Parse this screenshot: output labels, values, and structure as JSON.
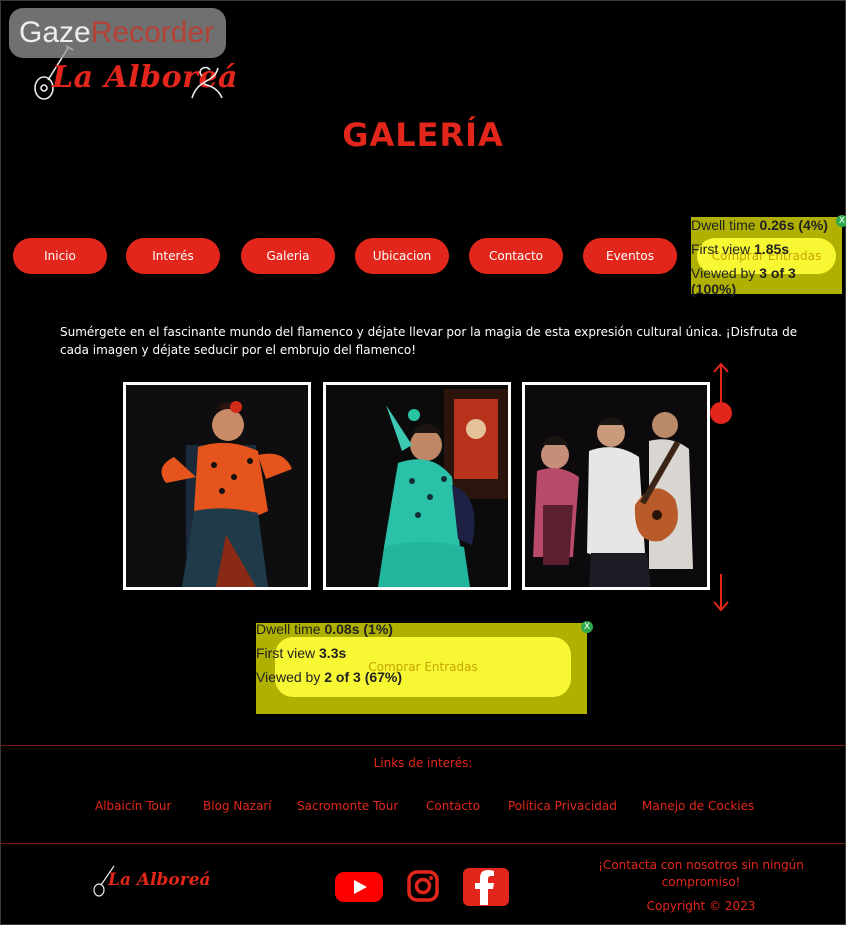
{
  "recorder": {
    "brand_part1": "Gaze",
    "brand_part2": "Recorder"
  },
  "logo": {
    "text": "La Alboreá"
  },
  "page": {
    "title": "GALERÍA"
  },
  "nav": {
    "items": [
      {
        "label": "Inicio"
      },
      {
        "label": "Interés"
      },
      {
        "label": "Galeria"
      },
      {
        "label": "Ubicacion"
      },
      {
        "label": "Contacto"
      },
      {
        "label": "Eventos"
      },
      {
        "label": "Comprar Entradas"
      }
    ]
  },
  "intro": "Sumérgete en el fascinante mundo del flamenco y déjate llevar por la magia de esta expresión cultural única. ¡Disfruta de cada imagen y déjate seducir por el embrujo del flamenco!",
  "gallery": {
    "photos": [
      {
        "alt": "Bailaora con vestido naranja de lunares"
      },
      {
        "alt": "Bailaora con vestido verde de lunares"
      },
      {
        "alt": "Bailaora y guitarrista en escenario"
      }
    ]
  },
  "overlays": [
    {
      "dwell_label": "Dwell time",
      "dwell_value": "0.26s (4%)",
      "first_label": "First view",
      "first_value": "1.85s",
      "viewed_label": "Viewed by",
      "viewed_value": "3 of 3 (100%)",
      "close": "X"
    },
    {
      "dwell_label": "Dwell time",
      "dwell_value": "0.08s (1%)",
      "first_label": "First view",
      "first_value": "3.3s",
      "viewed_label": "Viewed by",
      "viewed_value": "2 of 3 (67%)",
      "cta": "Comprar Entradas",
      "close": "X"
    }
  ],
  "footer": {
    "links_title": "Links de interés:",
    "links": [
      {
        "label": "Albaicín Tour"
      },
      {
        "label": "Blog Nazarí"
      },
      {
        "label": "Sacromonte Tour"
      },
      {
        "label": "Contacto"
      },
      {
        "label": "Política Privacidad"
      },
      {
        "label": "Manejo de Cockies"
      }
    ],
    "logo_text": "La Alboreá",
    "contact_cta": "¡Contacta con nosotros sin ningún compromiso!",
    "copyright": "Copyright © 2023"
  },
  "colors": {
    "accent": "#e3261b",
    "background": "#000000",
    "overlay": "#c8c800",
    "highlight": "#ffff3a"
  },
  "icons": [
    "youtube-icon",
    "instagram-icon",
    "facebook-icon",
    "arrow-up-icon",
    "arrow-down-icon",
    "guitar-icon"
  ]
}
